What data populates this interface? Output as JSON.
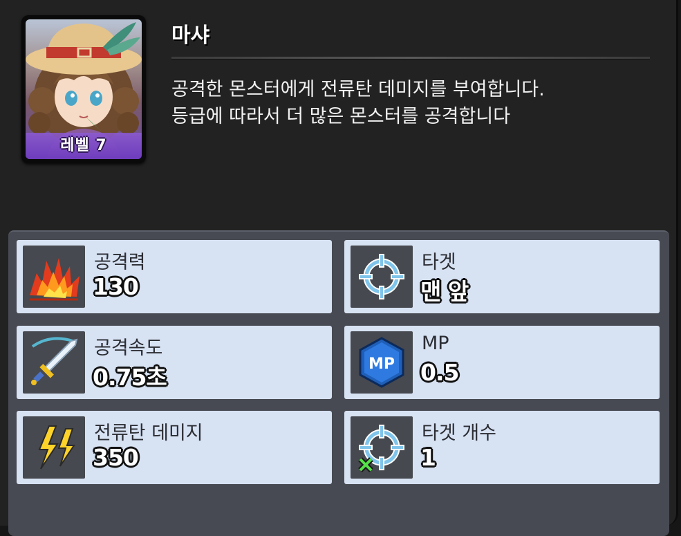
{
  "unit": {
    "name": "마샤",
    "level_label": "레벨 7",
    "description": "공격한 몬스터에게 전류탄 데미지를 부여합니다.\n등급에 따라서 더 많은 몬스터를 공격합니다"
  },
  "stats": [
    {
      "icon": "explosion-icon",
      "label": "공격력",
      "value": "130"
    },
    {
      "icon": "crosshair-icon",
      "label": "타겟",
      "value": "맨 앞"
    },
    {
      "icon": "sword-icon",
      "label": "공격속도",
      "value": "0.75초"
    },
    {
      "icon": "mp-hexagon-icon",
      "label": "MP",
      "value": "0.5"
    },
    {
      "icon": "lightning-icon",
      "label": "전류탄 데미지",
      "value": "350"
    },
    {
      "icon": "multi-target-icon",
      "label": "타겟 개수",
      "value": "1"
    }
  ]
}
